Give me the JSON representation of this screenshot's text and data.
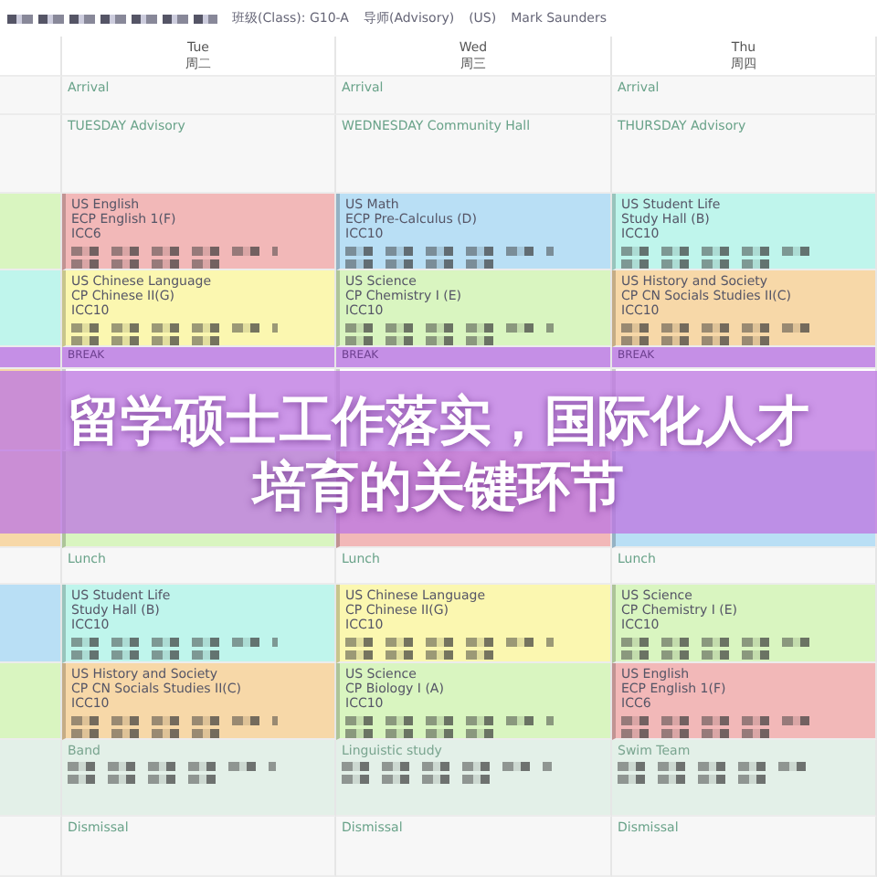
{
  "header": {
    "redacted": true,
    "fields": [
      "班级(Class): G10-A",
      "导师(Advisory)",
      "(US)",
      "Mark Saunders"
    ]
  },
  "days": [
    {
      "name": "Tue",
      "name_zh": "周二"
    },
    {
      "name": "Wed",
      "name_zh": "周三"
    },
    {
      "name": "Thu",
      "name_zh": "周四"
    }
  ],
  "rows": [
    {
      "kind": "event",
      "cells": [
        {
          "lines": [
            "Arrival"
          ]
        },
        {
          "lines": [
            "Arrival"
          ]
        },
        {
          "lines": [
            "Arrival"
          ]
        }
      ]
    },
    {
      "kind": "event",
      "cells": [
        {
          "lines": [
            "TUESDAY Advisory"
          ]
        },
        {
          "lines": [
            "WEDNESDAY Community Hall"
          ]
        },
        {
          "lines": [
            "THURSDAY Advisory"
          ]
        }
      ]
    },
    {
      "kind": "class",
      "left": {
        "color": "#d9f5c0"
      },
      "cells": [
        {
          "color": "#f2b8b8",
          "lines": [
            "US English",
            "ECP English 1(F)",
            "ICC6"
          ],
          "redacted": true
        },
        {
          "color": "#b9dff5",
          "lines": [
            "US Math",
            "ECP Pre-Calculus (D)",
            "ICC10"
          ],
          "redacted": true
        },
        {
          "color": "#bff5ec",
          "lines": [
            "US Student Life",
            "Study Hall (B)",
            "ICC10"
          ],
          "redacted": true
        }
      ]
    },
    {
      "kind": "class",
      "left": {
        "color": "#bff5ec"
      },
      "cells": [
        {
          "color": "#fbf7b0",
          "lines": [
            "US Chinese Language",
            "CP Chinese II(G)",
            "ICC10"
          ],
          "redacted": true
        },
        {
          "color": "#d9f5c0",
          "lines": [
            "US Science",
            "CP Chemistry I (E)",
            "ICC10"
          ],
          "redacted": true
        },
        {
          "color": "#f7d8a8",
          "lines": [
            "US History and Society",
            "CP CN Socials Studies II(C)",
            "ICC10"
          ],
          "redacted": true
        }
      ]
    },
    {
      "kind": "break",
      "cells": [
        {
          "lines": [
            "BREAK"
          ]
        },
        {
          "lines": [
            "BREAK"
          ]
        },
        {
          "lines": [
            "BREAK"
          ]
        }
      ]
    },
    {
      "kind": "class",
      "left": {
        "color": "#f7d8a8"
      },
      "cells": [
        {},
        {},
        {}
      ]
    },
    {
      "kind": "class",
      "left": {
        "color": "#f7d8a8"
      },
      "cells": [
        {
          "color": "#d9f5c0"
        },
        {
          "color": "#f2b8b8"
        },
        {
          "color": "#b9dff5"
        }
      ]
    },
    {
      "kind": "event",
      "cells": [
        {
          "lines": [
            "Lunch"
          ]
        },
        {
          "lines": [
            "Lunch"
          ]
        },
        {
          "lines": [
            "Lunch"
          ]
        }
      ]
    },
    {
      "kind": "class",
      "left": {
        "color": "#b9dff5"
      },
      "cells": [
        {
          "color": "#bff5ec",
          "lines": [
            "US Student Life",
            "Study Hall (B)",
            "ICC10"
          ],
          "redacted": true
        },
        {
          "color": "#fbf7b0",
          "lines": [
            "US Chinese Language",
            "CP Chinese II(G)",
            "ICC10"
          ],
          "redacted": true
        },
        {
          "color": "#d9f5c0",
          "lines": [
            "US Science",
            "CP Chemistry I (E)",
            "ICC10"
          ],
          "redacted": true
        }
      ]
    },
    {
      "kind": "class",
      "left": {
        "color": "#d9f5c0"
      },
      "cells": [
        {
          "color": "#f7d8a8",
          "lines": [
            "US History and Society",
            "CP CN Socials Studies II(C)",
            "ICC10"
          ],
          "redacted": true
        },
        {
          "color": "#d9f5c0",
          "lines": [
            "US Science",
            "CP Biology I (A)",
            "ICC10"
          ],
          "redacted": true
        },
        {
          "color": "#f2b8b8",
          "lines": [
            "US English",
            "ECP English 1(F)",
            "ICC6"
          ],
          "redacted": true
        }
      ]
    },
    {
      "kind": "activity",
      "left": {
        "color": "#e3f0e8"
      },
      "cells": [
        {
          "lines": [
            "Band"
          ],
          "redacted": true
        },
        {
          "lines": [
            "Linguistic study"
          ],
          "redacted": true
        },
        {
          "lines": [
            "Swim Team"
          ],
          "redacted": true
        }
      ]
    },
    {
      "kind": "event",
      "cells": [
        {
          "lines": [
            "Dismissal"
          ]
        },
        {
          "lines": [
            "Dismissal"
          ]
        },
        {
          "lines": [
            "Dismissal"
          ]
        }
      ]
    }
  ],
  "banner": {
    "title": "留学硕士工作落实，国际化人才培育的关键环节"
  }
}
